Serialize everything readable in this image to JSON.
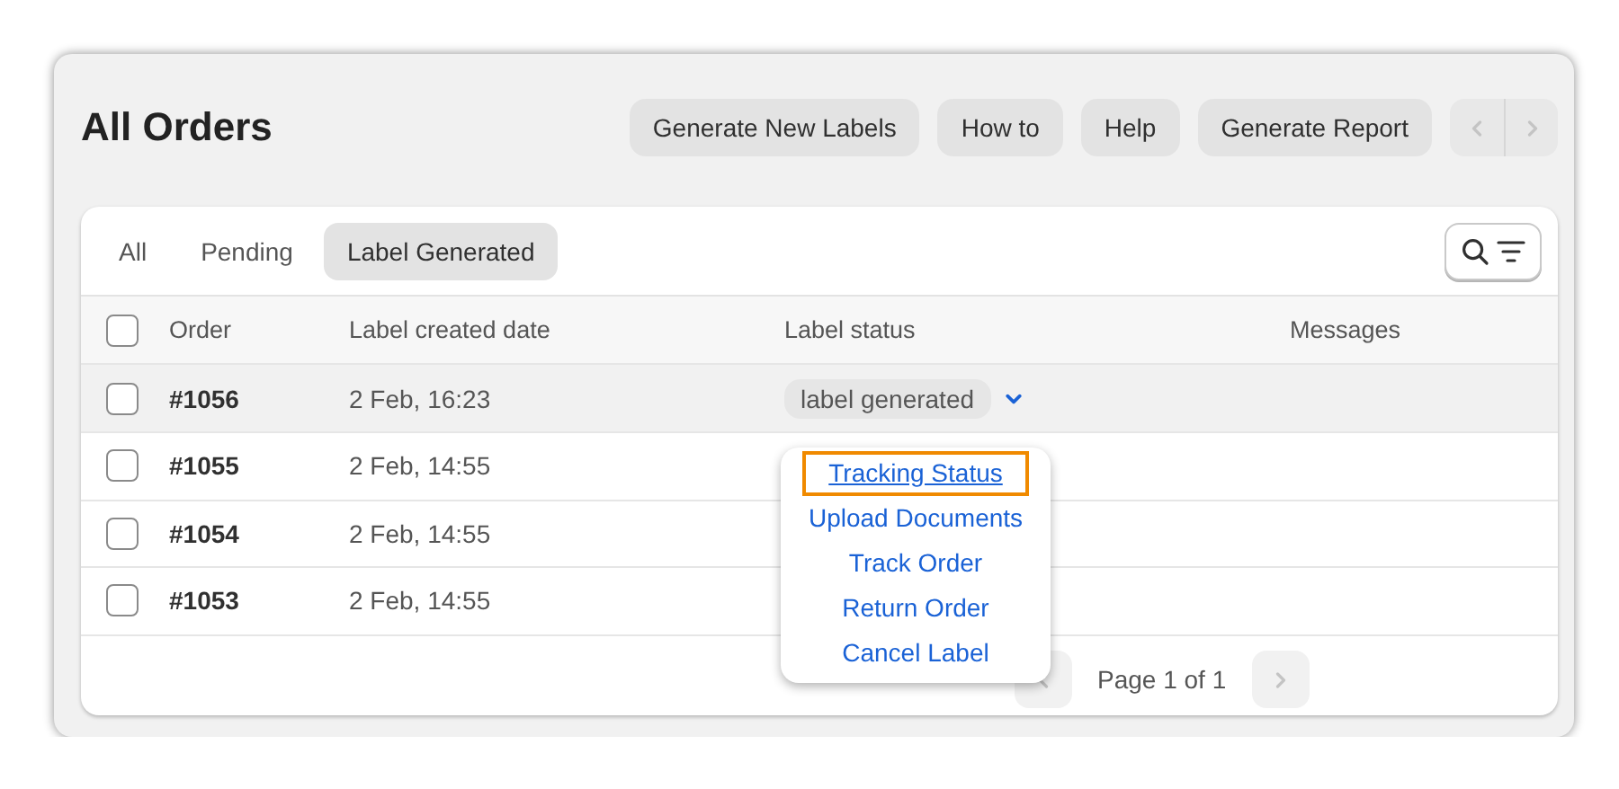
{
  "title": "All Orders",
  "actions": [
    "Generate New Labels",
    "How to",
    "Help",
    "Generate Report"
  ],
  "pager_nav": {
    "prev_disabled": true,
    "next_disabled": true
  },
  "tabs": [
    {
      "label": "All",
      "selected": false
    },
    {
      "label": "Pending",
      "selected": false
    },
    {
      "label": "Label Generated",
      "selected": true
    }
  ],
  "table": {
    "select_all_checked": false,
    "columns": [
      "Order",
      "Label created date",
      "Label status",
      "Messages"
    ],
    "rows": [
      {
        "order": "#1056",
        "date": "2 Feb, 16:23",
        "status": "label generated",
        "highlighted": true,
        "checked": false
      },
      {
        "order": "#1055",
        "date": "2 Feb, 14:55",
        "highlighted": false,
        "checked": false
      },
      {
        "order": "#1054",
        "date": "2 Feb, 14:55",
        "highlighted": false,
        "checked": false
      },
      {
        "order": "#1053",
        "date": "2 Feb, 14:55",
        "highlighted": false,
        "checked": false
      }
    ]
  },
  "status_menu": {
    "items": [
      {
        "label": "Tracking Status",
        "focused": true
      },
      {
        "label": "Upload Documents",
        "focused": false
      },
      {
        "label": "Track Order",
        "focused": false
      },
      {
        "label": "Return Order",
        "focused": false
      },
      {
        "label": "Cancel Label",
        "focused": false
      }
    ]
  },
  "pagination": {
    "text": "Page 1 of 1",
    "prev_disabled": true,
    "next_disabled": true
  }
}
